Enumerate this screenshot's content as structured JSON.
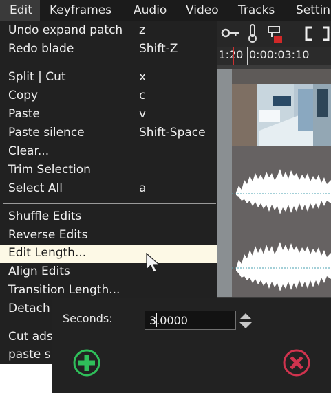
{
  "menubar": {
    "items": [
      {
        "label": "Edit"
      },
      {
        "label": "Keyframes"
      },
      {
        "label": "Audio"
      },
      {
        "label": "Video"
      },
      {
        "label": "Tracks"
      },
      {
        "label": "Settin"
      }
    ]
  },
  "edit_menu": {
    "items": [
      {
        "label": "Undo expand patch",
        "shortcut": "z"
      },
      {
        "label": "Redo blade",
        "shortcut": "Shift-Z"
      },
      {
        "label": "Split | Cut",
        "shortcut": "x"
      },
      {
        "label": "Copy",
        "shortcut": "c"
      },
      {
        "label": "Paste",
        "shortcut": "v"
      },
      {
        "label": "Paste silence",
        "shortcut": "Shift-Space"
      },
      {
        "label": "Clear...",
        "shortcut": ""
      },
      {
        "label": "Trim Selection",
        "shortcut": ""
      },
      {
        "label": "Select All",
        "shortcut": "a"
      },
      {
        "label": "Shuffle Edits",
        "shortcut": ""
      },
      {
        "label": "Reverse Edits",
        "shortcut": ""
      },
      {
        "label": "Edit Length...",
        "shortcut": ""
      },
      {
        "label": "Align Edits",
        "shortcut": ""
      },
      {
        "label": "Transition Length...",
        "shortcut": ""
      },
      {
        "label": "Detach",
        "shortcut": ""
      },
      {
        "label": "Cut ads",
        "shortcut": ""
      },
      {
        "label": "paste s",
        "shortcut": ""
      }
    ],
    "highlighted": "Edit Length..."
  },
  "timeline": {
    "ruler_left": ":1:20",
    "ruler_right": "0:00:03:10"
  },
  "dialog": {
    "seconds_label": "Seconds:",
    "seconds_value": "3.0000"
  },
  "colors": {
    "ok": "#2fbf5a",
    "cancel": "#d0334e",
    "highlight": "#fdf9e6"
  }
}
